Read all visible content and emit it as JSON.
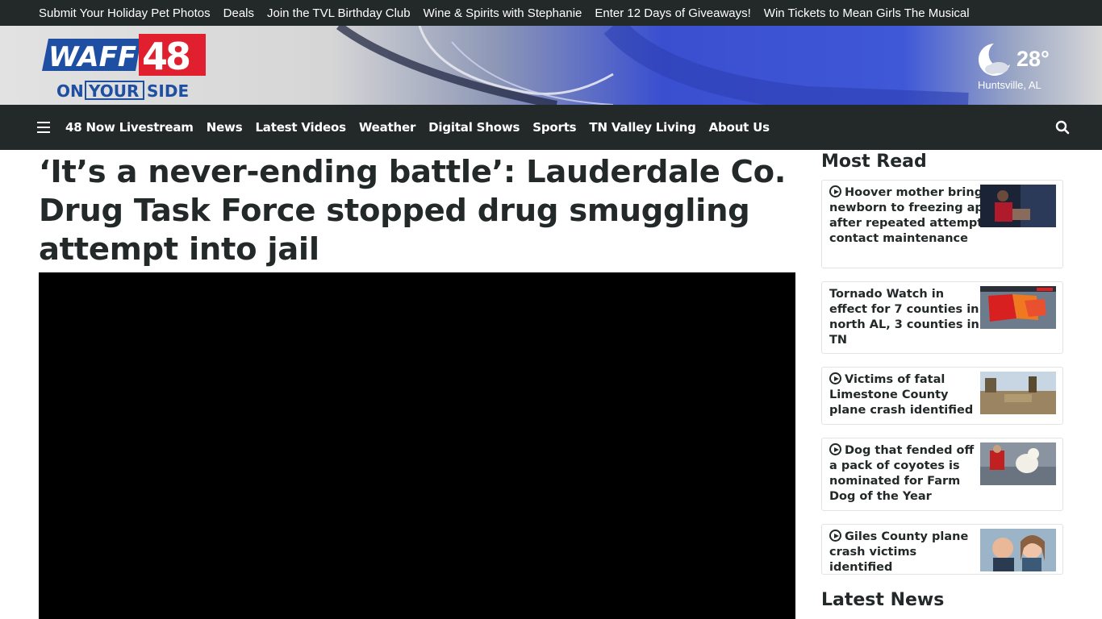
{
  "promo_links": [
    "Submit Your Holiday Pet Photos",
    "Deals",
    "Join the TVL Birthday Club",
    "Wine & Spirits with Stephanie",
    "Enter 12 Days of Giveaways!",
    "Win Tickets to Mean Girls The Musical"
  ],
  "logo": {
    "brand": "WAFF",
    "number": "48",
    "tagline_on": "ON",
    "tagline_your": "YOUR",
    "tagline_side": "SIDE"
  },
  "weather": {
    "temp": "28°",
    "location": "Huntsville, AL",
    "icon": "moon-cloud-icon"
  },
  "nav": {
    "items": [
      "48 Now Livestream",
      "News",
      "Latest Videos",
      "Weather",
      "Digital Shows",
      "Sports",
      "TN Valley Living",
      "About Us"
    ]
  },
  "article": {
    "headline": "‘It’s a never-ending battle’: Lauderdale Co. Drug Task Force stopped drug smuggling attempt into jail"
  },
  "sidebar": {
    "most_read_title": "Most Read",
    "latest_news_title": "Latest News",
    "stories": [
      {
        "title": "Hoover mother brings home newborn to freezing apartment after repeated attempts to contact maintenance",
        "video": true
      },
      {
        "title": "Tornado Watch in effect for 7 counties in north AL, 3 counties in TN",
        "video": false
      },
      {
        "title": "Victims of fatal Limestone County plane crash identified",
        "video": true
      },
      {
        "title": "Dog that fended off a pack of coyotes is nominated for Farm Dog of the Year",
        "video": true
      },
      {
        "title": "Giles County plane crash victims identified",
        "video": true
      }
    ]
  },
  "colors": {
    "dark": "#232829",
    "brand_blue": "#1f4fa3",
    "brand_red": "#e0202e"
  }
}
